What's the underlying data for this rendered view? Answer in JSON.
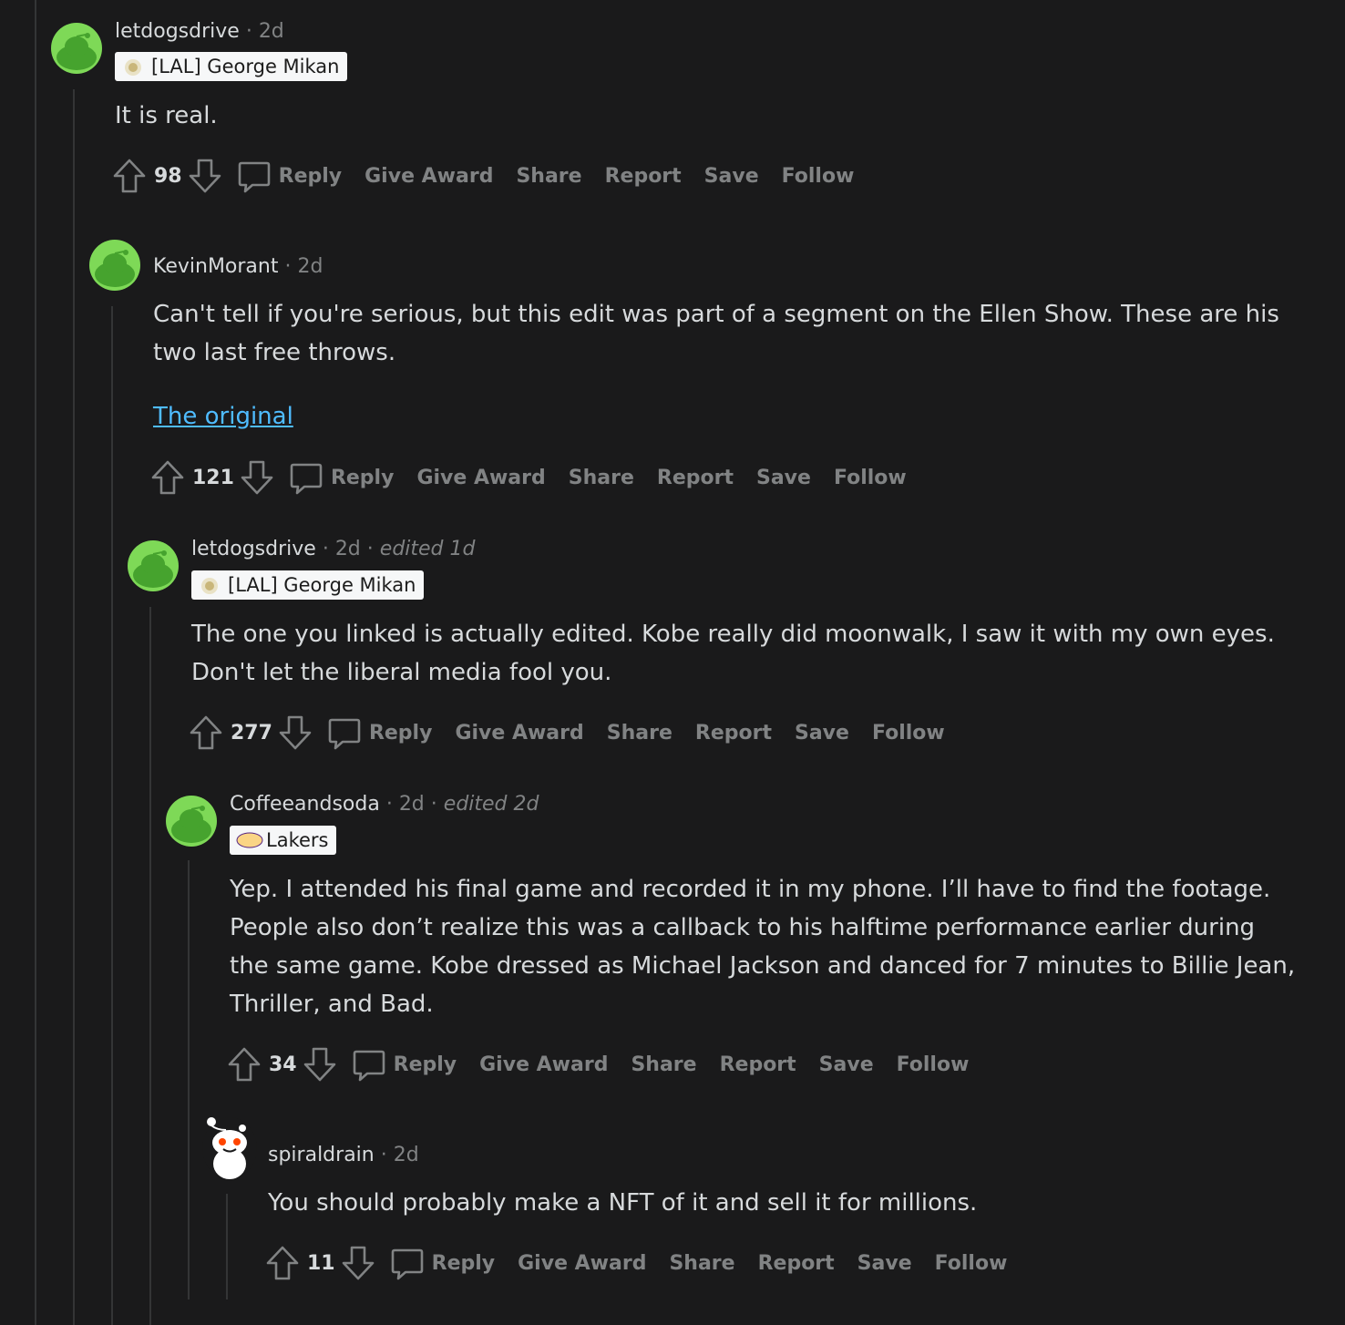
{
  "colors": {
    "background": "#1a1a1b",
    "text": "#d7dadc",
    "muted": "#818384",
    "link": "#4fbcff",
    "avatar_green": "#7ed957",
    "flair_bg": "#f6f7f8"
  },
  "actions": {
    "reply": "Reply",
    "give_award": "Give Award",
    "share": "Share",
    "report": "Report",
    "save": "Save",
    "follow": "Follow"
  },
  "separator": "·",
  "comments": [
    {
      "user": "letdogsdrive",
      "time": "2d",
      "flair": "[LAL] George Mikan",
      "flair_icon": "george-mikan-flair-icon",
      "body": [
        "It is real."
      ],
      "score": "98"
    },
    {
      "user": "KevinMorant",
      "time": "2d",
      "body": [
        "Can't tell if you're serious, but this edit was part of a segment on the Ellen Show. These are his two last free throws."
      ],
      "link": "The original",
      "score": "121"
    },
    {
      "user": "letdogsdrive",
      "time": "2d",
      "edited": "edited 1d",
      "flair": "[LAL] George Mikan",
      "flair_icon": "george-mikan-flair-icon",
      "body": [
        "The one you linked is actually edited. Kobe really did moonwalk, I saw it with my own eyes. Don't let the liberal media fool you."
      ],
      "score": "277"
    },
    {
      "user": "Coffeeandsoda",
      "time": "2d",
      "edited": "edited 2d",
      "flair": "Lakers",
      "flair_icon": "lakers-logo-icon",
      "body": [
        "Yep. I attended his final game and recorded it in my phone. I’ll have to find the footage. People also don’t realize this was a callback to his halftime performance earlier during the same game. Kobe dressed as Michael Jackson and danced for 7 minutes to Billie Jean, Thriller, and Bad."
      ],
      "score": "34"
    },
    {
      "user": "spiraldrain",
      "time": "2d",
      "avatar": "snoo-avatar",
      "body": [
        "You should probably make a NFT of it and sell it for millions."
      ],
      "score": "11"
    }
  ]
}
